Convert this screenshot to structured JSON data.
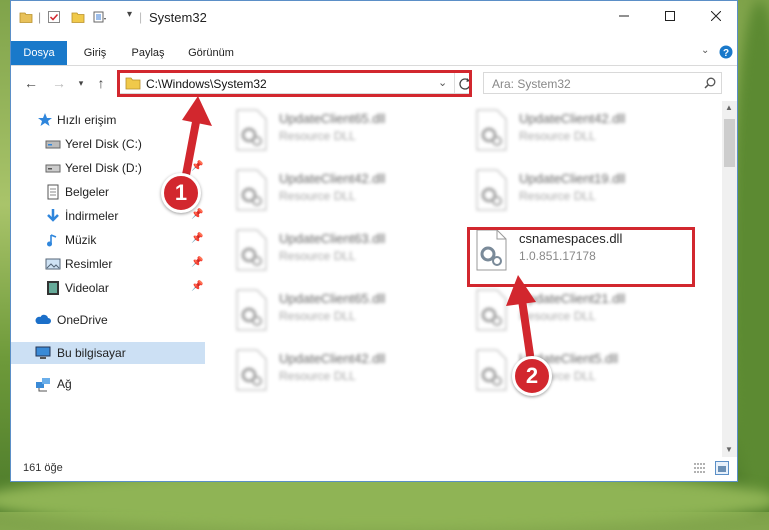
{
  "window": {
    "title": "System32",
    "controls": [
      "minimize-icon",
      "maximize-icon",
      "close-icon"
    ]
  },
  "ribbon": {
    "tabs": [
      {
        "label": "Dosya"
      },
      {
        "label": "Giriş"
      },
      {
        "label": "Paylaş"
      },
      {
        "label": "Görünüm"
      }
    ],
    "help_icon": "help-icon"
  },
  "address": {
    "path": "C:\\Windows\\System32",
    "search_placeholder": "Ara: System32"
  },
  "sidebar": {
    "items": [
      {
        "label": "Hızlı erişim",
        "icon": "star-icon"
      },
      {
        "label": "Yerel Disk (C:)",
        "icon": "drive-icon"
      },
      {
        "label": "Yerel Disk (D:)",
        "icon": "drive-icon"
      },
      {
        "label": "Belgeler",
        "icon": "documents-icon"
      },
      {
        "label": "İndirmeler",
        "icon": "download-icon"
      },
      {
        "label": "Müzik",
        "icon": "music-icon"
      },
      {
        "label": "Resimler",
        "icon": "pictures-icon"
      },
      {
        "label": "Videolar",
        "icon": "video-icon"
      },
      {
        "label": "OneDrive",
        "icon": "cloud-icon"
      },
      {
        "label": "Bu bilgisayar",
        "icon": "computer-icon"
      },
      {
        "label": "Ağ",
        "icon": "network-icon"
      }
    ]
  },
  "files": [
    {
      "name": "UpdateClient65.dll",
      "type": "Resource DLL"
    },
    {
      "name": "UpdateClient42.dll",
      "type": "Resource DLL"
    },
    {
      "name": "UpdateClient42.dll",
      "type": "Resource DLL"
    },
    {
      "name": "UpdateClient19.dll",
      "type": "Resource DLL"
    },
    {
      "name": "UpdateClient63.dll",
      "type": "Resource DLL"
    },
    {
      "name": "csnamespaces.dll",
      "type": "1.0.851.17178"
    },
    {
      "name": "UpdateClient65.dll",
      "type": "Resource DLL"
    },
    {
      "name": "UpdateClient21.dll",
      "type": "Resource DLL"
    },
    {
      "name": "UpdateClient42.dll",
      "type": "Resource DLL"
    },
    {
      "name": "UpdateClient5.dll",
      "type": "Resource DLL"
    }
  ],
  "status": {
    "count": "161 öğe"
  },
  "annotations": {
    "badge1": "1",
    "badge2": "2"
  },
  "colors": {
    "accent": "#1979ca",
    "highlight": "#d2272e",
    "selection": "#cce0f4"
  }
}
